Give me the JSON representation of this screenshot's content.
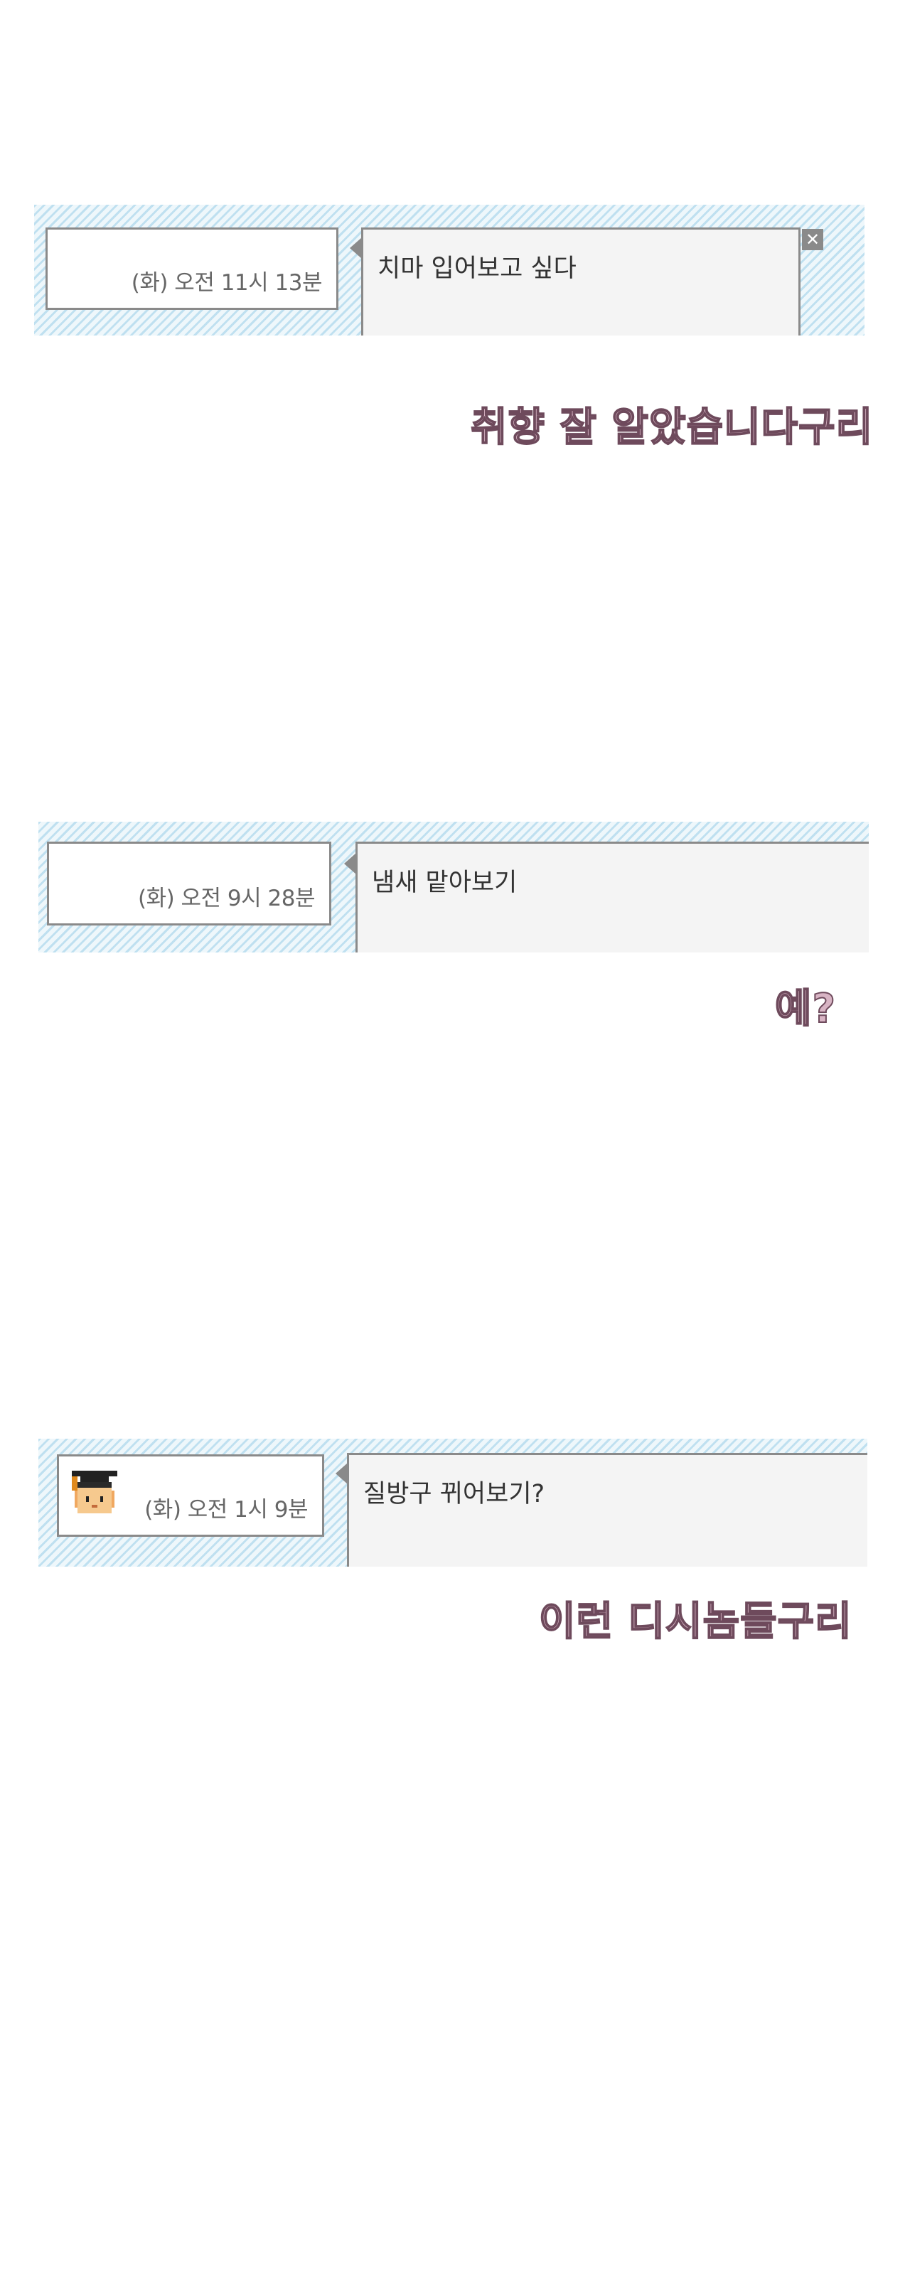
{
  "messages": [
    {
      "timestamp": "(화) 오전 11시 13분",
      "text": "치마 입어보고 싶다",
      "has_close": true,
      "close_label": "✕"
    },
    {
      "timestamp": "(화) 오전 9시 28분",
      "text": "냄새 맡아보기",
      "has_close": false
    },
    {
      "timestamp": "(화) 오전 1시 9분",
      "text": "질방구 뀌어보기?",
      "has_close": false,
      "avatar": "graduation-cap-avatar-icon"
    }
  ],
  "captions": [
    "취향 잘 알았습니다구리",
    "예?",
    "이런 디시놈들구리"
  ],
  "colors": {
    "strip_light": "#eef7fb",
    "strip_dark": "#bfe0f0",
    "border": "#8a8a8a",
    "bubble_bg": "#f4f4f4",
    "caption_fill": "#d8b4c4",
    "caption_stroke": "#6e4a5c"
  }
}
